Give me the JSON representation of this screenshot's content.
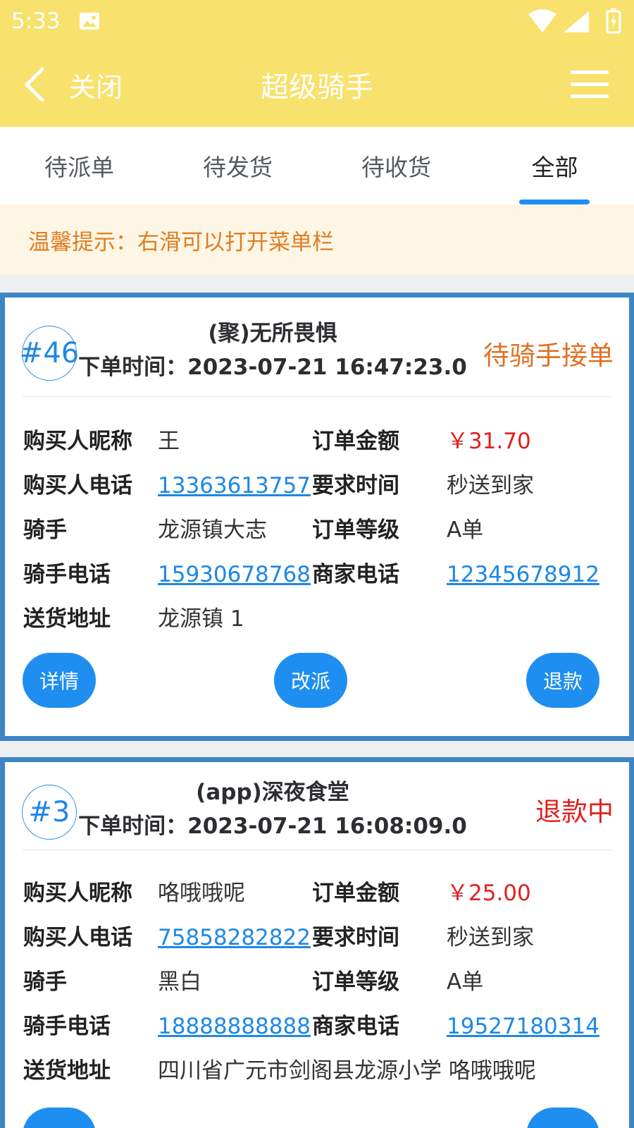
{
  "status_bar": {
    "time": "5:33"
  },
  "header": {
    "back_label": "关闭",
    "title": "超级骑手"
  },
  "tabs": [
    {
      "label": "待派单",
      "active": false
    },
    {
      "label": "待发货",
      "active": false
    },
    {
      "label": "待收货",
      "active": false
    },
    {
      "label": "全部",
      "active": true
    }
  ],
  "tip": "温馨提示：右滑可以打开菜单栏",
  "labels": {
    "buyer_name": "购买人昵称",
    "buyer_phone": "购买人电话",
    "rider": "骑手",
    "rider_phone": "骑手电话",
    "address": "送货地址",
    "amount": "订单金额",
    "required_time": "要求时间",
    "order_level": "订单等级",
    "merchant_phone": "商家电话"
  },
  "orders": [
    {
      "number": "#46",
      "shop": "(聚)无所畏惧",
      "order_time": "下单时间：2023-07-21 16:47:23.0",
      "status": "待骑手接单",
      "status_color": "#e07022",
      "buyer_name": "王",
      "buyer_phone": "13363613757",
      "rider": "龙源镇大志",
      "rider_phone": "15930678768",
      "address": "龙源镇 1",
      "amount": "￥31.70",
      "required_time": "秒送到家",
      "order_level": "A单",
      "merchant_phone": "12345678912",
      "buttons": [
        "详情",
        "改派",
        "退款"
      ]
    },
    {
      "number": "#3",
      "shop": "(app)深夜食堂",
      "order_time": "下单时间：2023-07-21 16:08:09.0",
      "status": "退款中",
      "status_color": "#e02020",
      "buyer_name": "咯哦哦呢",
      "buyer_phone": "75858282822",
      "rider": "黑白",
      "rider_phone": "18888888888",
      "address": "四川省广元市剑阁县龙源小学 咯哦哦呢",
      "amount": "￥25.00",
      "required_time": "秒送到家",
      "order_level": "A单",
      "merchant_phone": "19527180314"
    }
  ],
  "colors": {
    "header_bg": "#f8e16c",
    "accent": "#1e8ff0",
    "card_border": "#3d86c6",
    "tip_text": "#e07c22",
    "price": "#e02020"
  }
}
